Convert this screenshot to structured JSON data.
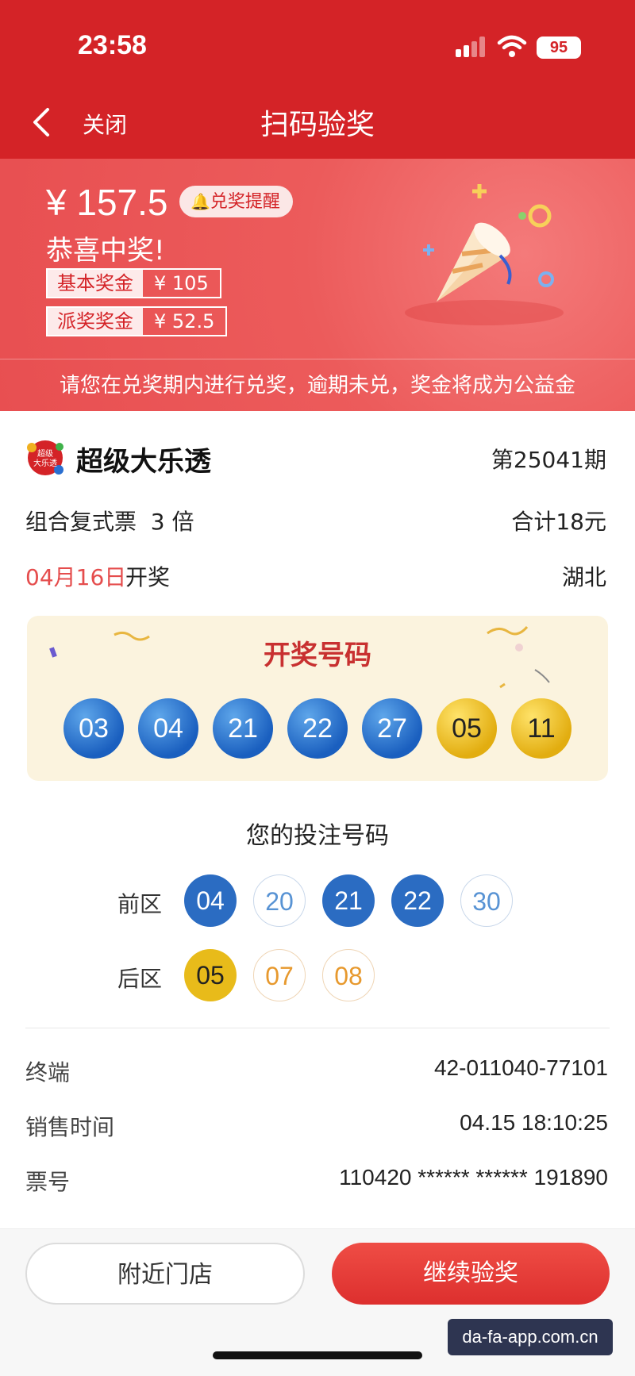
{
  "status_bar": {
    "time": "23:58",
    "battery": "95"
  },
  "nav": {
    "back_label": "关闭",
    "title": "扫码验奖"
  },
  "prize": {
    "amount": "¥ 157.5",
    "remind_label": "兑奖提醒",
    "congrats": "恭喜中奖!",
    "rows": [
      {
        "label": "基本奖金",
        "value": "¥ 105"
      },
      {
        "label": "派奖奖金",
        "value": "¥ 52.5"
      }
    ],
    "notice": "请您在兑奖期内进行兑奖，逾期未兑，奖金将成为公益金"
  },
  "ticket": {
    "logo_text": "超级大乐透",
    "lottery_name": "超级大乐透",
    "issue": "第25041期",
    "ticket_type": "组合复式票  3 倍",
    "total": "合计18元",
    "draw_date": "04月16日",
    "draw_suffix": "开奖",
    "region": "湖北"
  },
  "winning": {
    "title": "开奖号码",
    "front": [
      "03",
      "04",
      "21",
      "22",
      "27"
    ],
    "back": [
      "05",
      "11"
    ]
  },
  "your_numbers": {
    "title": "您的投注号码",
    "front_label": "前区",
    "back_label": "后区",
    "front": [
      {
        "n": "04",
        "hit": true
      },
      {
        "n": "20",
        "hit": false
      },
      {
        "n": "21",
        "hit": true
      },
      {
        "n": "22",
        "hit": true
      },
      {
        "n": "30",
        "hit": false
      }
    ],
    "back": [
      {
        "n": "05",
        "hit": true
      },
      {
        "n": "07",
        "hit": false
      },
      {
        "n": "08",
        "hit": false
      }
    ]
  },
  "info": [
    {
      "label": "终端",
      "value": "42-011040-77101"
    },
    {
      "label": "销售时间",
      "value": "04.15 18:10:25"
    },
    {
      "label": "票号",
      "value": "110420 ****** ****** 191890"
    }
  ],
  "buttons": {
    "nearby": "附近门店",
    "continue": "继续验奖"
  },
  "watermark": "da-fa-app.com.cn",
  "colors": {
    "brand_red": "#d42327",
    "ball_blue": "#1a5fbf",
    "ball_yellow": "#e2ad10"
  }
}
